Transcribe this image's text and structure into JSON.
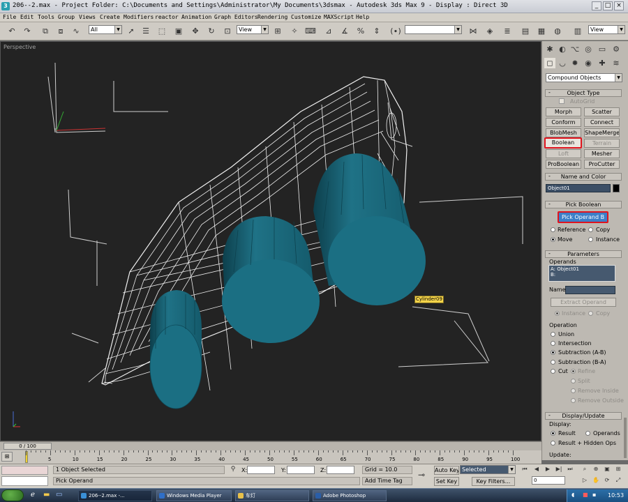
{
  "window": {
    "title": "206--2.max    - Project Folder: C:\\Documents and Settings\\Administrator\\My Documents\\3dsmax    - Autodesk 3ds Max 9    - Display : Direct 3D"
  },
  "menu": [
    "File",
    "Edit",
    "Tools",
    "Group",
    "Views",
    "Create",
    "Modifiers",
    "reactor",
    "Animation",
    "Graph Editors",
    "Rendering",
    "Customize",
    "MAXScript",
    "Help"
  ],
  "toolbar": {
    "selection_filter": "All",
    "ref_coord": "View",
    "named_selection": "",
    "view_dropdown": "View"
  },
  "viewport": {
    "label": "Perspective",
    "tooltip": "Cylinder09"
  },
  "command_panel": {
    "category": "Compound Objects",
    "object_type_title": "Object Type",
    "autogrid": "AutoGrid",
    "buttons": [
      {
        "label": "Morph",
        "enabled": true
      },
      {
        "label": "Scatter",
        "enabled": true
      },
      {
        "label": "Conform",
        "enabled": true
      },
      {
        "label": "Connect",
        "enabled": true
      },
      {
        "label": "BlobMesh",
        "enabled": true
      },
      {
        "label": "ShapeMerge",
        "enabled": true
      },
      {
        "label": "Boolean",
        "enabled": true
      },
      {
        "label": "Terrain",
        "enabled": false
      },
      {
        "label": "Loft",
        "enabled": false
      },
      {
        "label": "Mesher",
        "enabled": true
      },
      {
        "label": "ProBoolean",
        "enabled": true
      },
      {
        "label": "ProCutter",
        "enabled": true
      }
    ],
    "name_color_title": "Name and Color",
    "object_name": "Object01",
    "object_color": "#000000",
    "pick_boolean_title": "Pick Boolean",
    "pick_operand": "Pick Operand B",
    "pick_modes": [
      "Reference",
      "Copy",
      "Move",
      "Instance"
    ],
    "parameters_title": "Parameters",
    "operands_label": "Operands",
    "operands": [
      "A: Object01",
      "B:"
    ],
    "name_label": "Name:",
    "extract_operand": "Extract Operand",
    "extract_modes": [
      "Instance",
      "Copy"
    ],
    "operation_label": "Operation",
    "operations": [
      "Union",
      "Intersection",
      "Subtraction (A-B)",
      "Subtraction (B-A)",
      "Cut"
    ],
    "cut_options": [
      "Refine",
      "Split",
      "Remove Inside",
      "Remove Outside"
    ],
    "display_update_title": "Display/Update",
    "display_label": "Display:",
    "display_options": [
      "Result",
      "Operands",
      "Result + Hidden Ops"
    ],
    "update_label": "Update:"
  },
  "timeline": {
    "slider": "0 / 100",
    "ticks": [
      "0",
      "5",
      "10",
      "15",
      "20",
      "25",
      "30",
      "35",
      "40",
      "45",
      "50",
      "55",
      "60",
      "65",
      "70",
      "75",
      "80",
      "85",
      "90",
      "95",
      "100"
    ]
  },
  "status": {
    "selected": "1 Object Selected",
    "prompt": "Pick Operand",
    "x_label": "X:",
    "y_label": "Y:",
    "z_label": "Z:",
    "grid": "Grid = 10.0",
    "add_time_tag": "Add Time Tag",
    "auto_key": "Auto Key",
    "set_key": "Set Key",
    "selected_dropdown": "Selected",
    "key_filters": "Key Filters...",
    "frame": "0"
  },
  "taskbar": {
    "tasks": [
      {
        "label": "206--2.max    -...",
        "color": "#3a8fd6",
        "active": true
      },
      {
        "label": "Windows Media Player",
        "color": "#2f6fc8",
        "active": false
      },
      {
        "label": "车灯",
        "color": "#e8c04a",
        "active": false
      },
      {
        "label": "Adobe Photoshop",
        "color": "#2a5ea8",
        "active": false
      }
    ],
    "clock": "10:53"
  },
  "colors": {
    "viewport_bg": "#232323",
    "cylinder": "#1f7286",
    "highlight": "#e0141e"
  }
}
